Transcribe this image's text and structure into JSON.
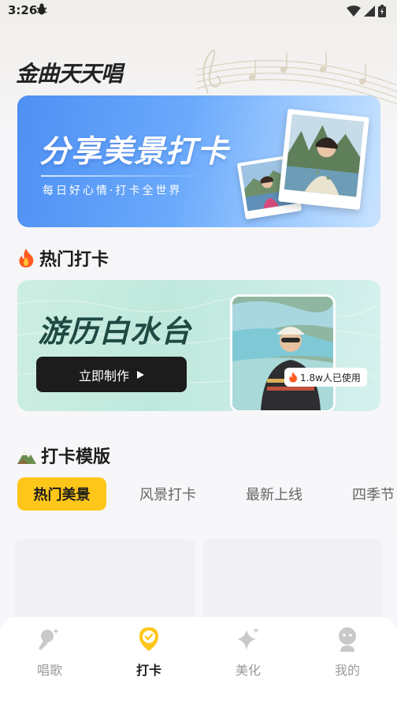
{
  "status_bar": {
    "time": "3:26",
    "notification_icon": "bug-icon",
    "icons": [
      "wifi-icon",
      "signal-icon",
      "battery-icon"
    ]
  },
  "header": {
    "app_title": "金曲天天唱"
  },
  "hero_banner": {
    "title": "分享美景打卡",
    "subtitle": "每日好心情·打卡全世界"
  },
  "hot_section": {
    "icon": "fire-icon",
    "title": "热门打卡",
    "card": {
      "title": "游历白水台",
      "button_label": "立即制作",
      "usage_count": "1.8w人已使用"
    }
  },
  "template_section": {
    "icon": "mountain-icon",
    "title": "打卡模版",
    "tabs": [
      {
        "label": "热门美景",
        "active": true
      },
      {
        "label": "风景打卡",
        "active": false
      },
      {
        "label": "最新上线",
        "active": false
      },
      {
        "label": "四季节",
        "active": false
      }
    ]
  },
  "bottom_nav": {
    "items": [
      {
        "label": "唱歌",
        "icon": "microphone-icon",
        "active": false
      },
      {
        "label": "打卡",
        "icon": "location-check-icon",
        "active": true
      },
      {
        "label": "美化",
        "icon": "sparkle-icon",
        "active": false
      },
      {
        "label": "我的",
        "icon": "profile-icon",
        "active": false
      }
    ]
  },
  "colors": {
    "accent": "#ffc61a",
    "hero_blue": "#5a9bf7",
    "card_mint": "#c6ebdf",
    "button_dark": "#1c1c1c"
  }
}
